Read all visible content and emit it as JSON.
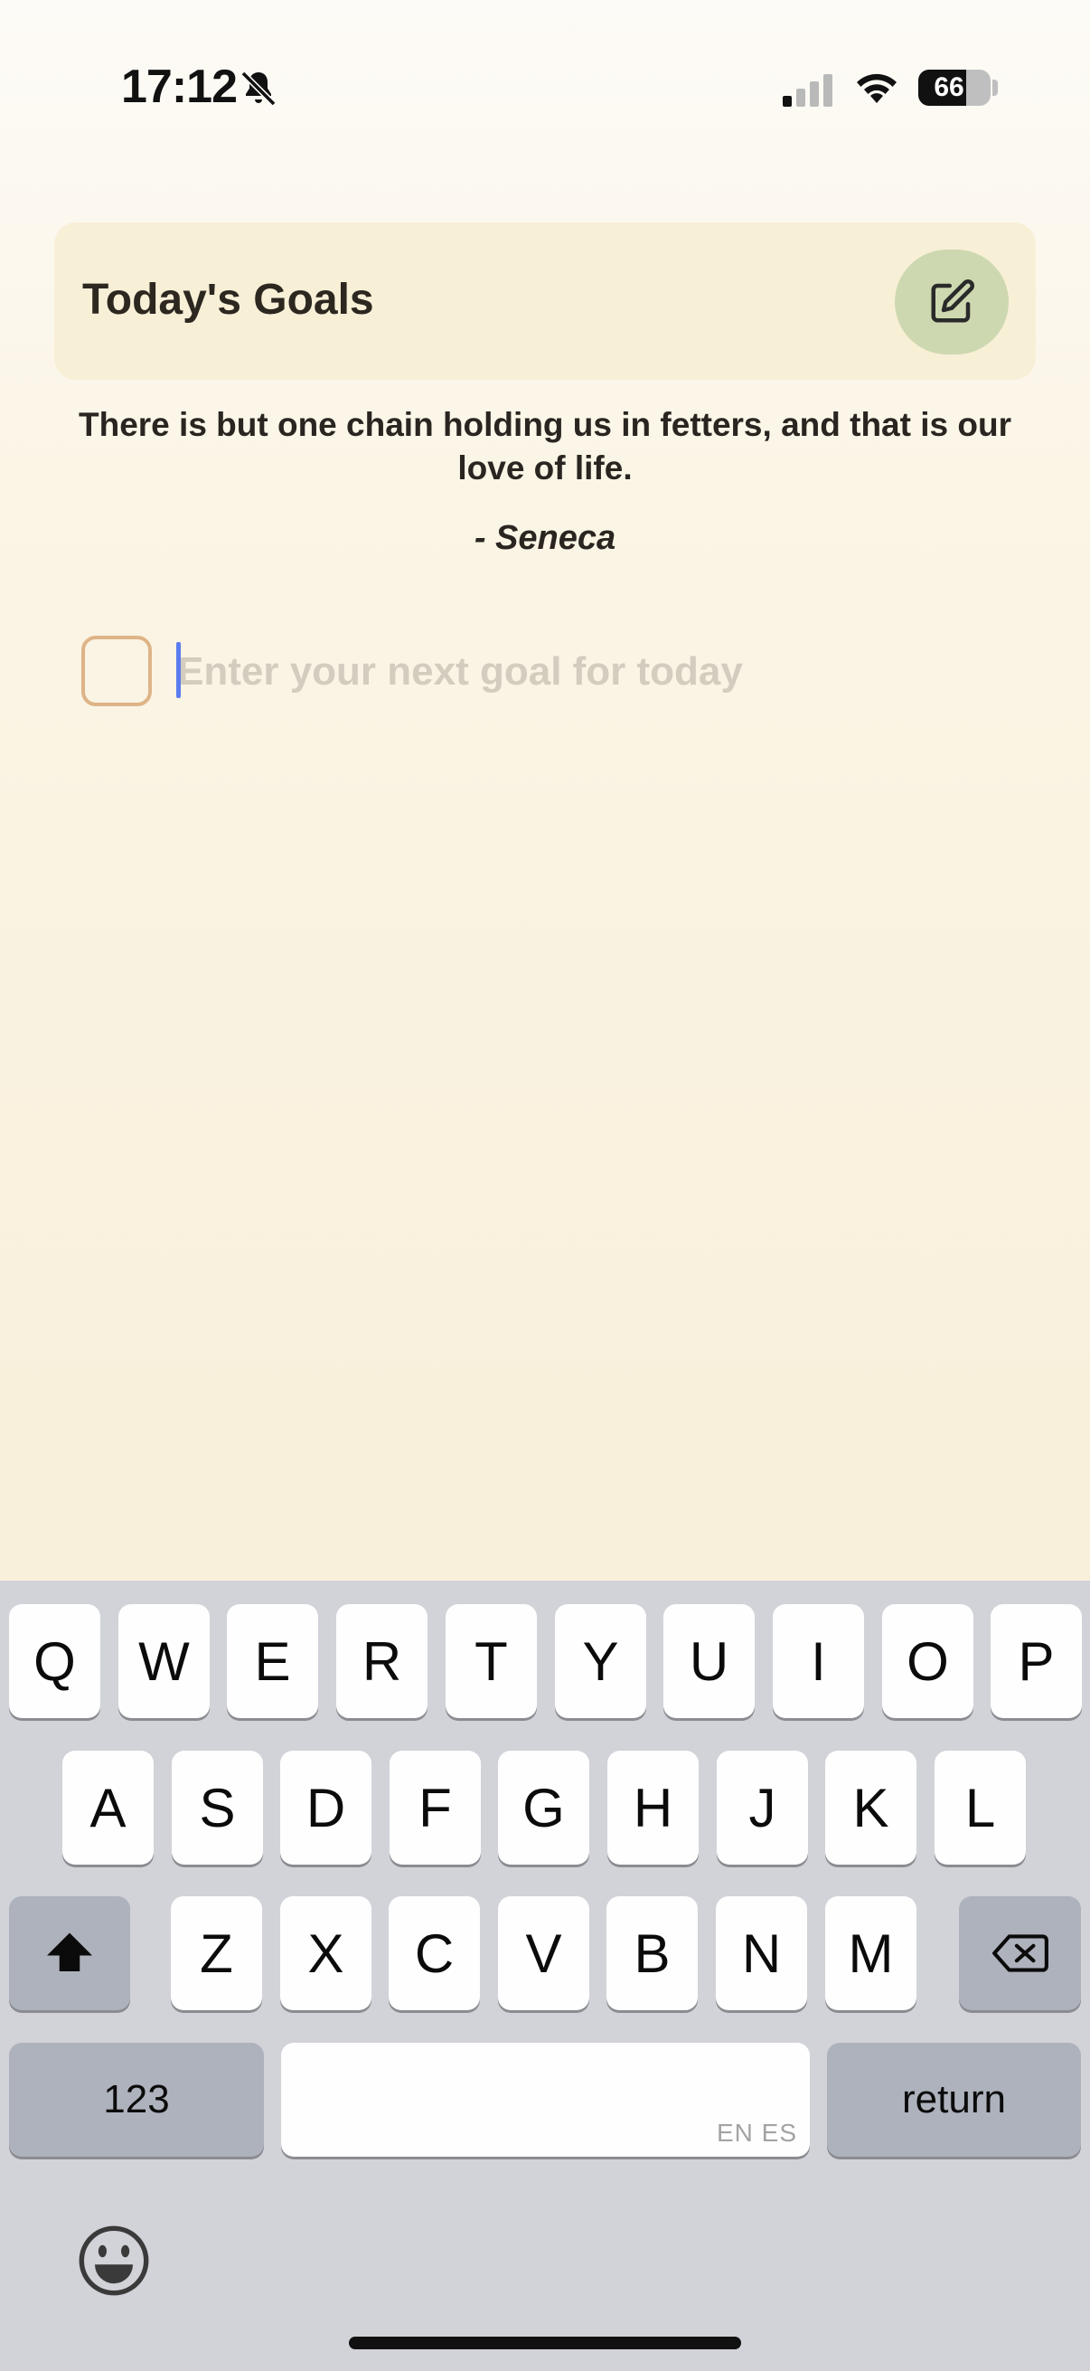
{
  "status_bar": {
    "time": "17:12",
    "battery_percent": "66",
    "battery_level": 0.66,
    "icons": [
      "bell-slash-icon",
      "cellular-signal-icon",
      "wifi-icon",
      "battery-icon"
    ]
  },
  "header": {
    "title": "Today's Goals",
    "edit_icon": "edit-pencil-icon"
  },
  "quote": {
    "text": "There is but one chain holding us in fetters, and that is our love of life.",
    "author": "- Seneca"
  },
  "goal_input": {
    "value": "",
    "placeholder": "Enter your next goal for today",
    "checked": false
  },
  "keyboard": {
    "row1": [
      "Q",
      "W",
      "E",
      "R",
      "T",
      "Y",
      "U",
      "I",
      "O",
      "P"
    ],
    "row2": [
      "A",
      "S",
      "D",
      "F",
      "G",
      "H",
      "J",
      "K",
      "L"
    ],
    "row3": [
      "Z",
      "X",
      "C",
      "V",
      "B",
      "N",
      "M"
    ],
    "numbers_label": "123",
    "return_label": "return",
    "space_hint": "EN ES",
    "shift_icon": "shift-icon",
    "delete_icon": "backspace-icon",
    "emoji_icon": "emoji-icon"
  },
  "colors": {
    "header_bg": "#f8efd7",
    "edit_button_bg": "#cdd8b0",
    "checkbox_border": "#deb487",
    "caret": "#5b7cf0",
    "keyboard_bg": "#d1d3d9"
  }
}
